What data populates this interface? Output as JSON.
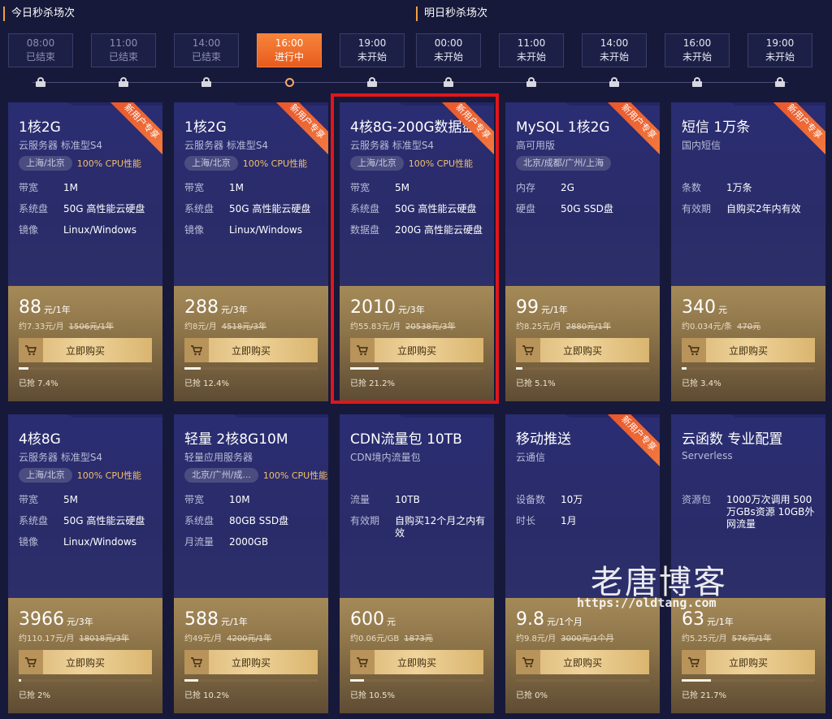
{
  "sessions": {
    "today": "今日秒杀场次",
    "tomorrow": "明日秒杀场次"
  },
  "slots": [
    {
      "time": "08:00",
      "status": "已结束"
    },
    {
      "time": "11:00",
      "status": "已结束"
    },
    {
      "time": "14:00",
      "status": "已结束"
    },
    {
      "time": "16:00",
      "status": "进行中"
    },
    {
      "time": "19:00",
      "status": "未开始"
    },
    {
      "time": "00:00",
      "status": "未开始"
    },
    {
      "time": "11:00",
      "status": "未开始"
    },
    {
      "time": "14:00",
      "status": "未开始"
    },
    {
      "time": "16:00",
      "status": "未开始"
    },
    {
      "time": "19:00",
      "status": "未开始"
    }
  ],
  "ribbon_text": "新用户专享",
  "buy_label": "立即购买",
  "cards": [
    {
      "title": "1核2G",
      "sub": "云服务器 标准型S4",
      "region": "上海/北京",
      "cpu": "100% CPU性能",
      "specs": [
        {
          "k": "带宽",
          "v": "1M"
        },
        {
          "k": "系统盘",
          "v": "50G 高性能云硬盘"
        },
        {
          "k": "镜像",
          "v": "Linux/Windows"
        }
      ],
      "price": "88",
      "unit": "元/1年",
      "per": "约7.33元/月",
      "orig": "1506元/1年",
      "sold": "已抢 7.4%",
      "progress": 0.074,
      "ribbon": true
    },
    {
      "title": "1核2G",
      "sub": "云服务器 标准型S4",
      "region": "上海/北京",
      "cpu": "100% CPU性能",
      "specs": [
        {
          "k": "带宽",
          "v": "1M"
        },
        {
          "k": "系统盘",
          "v": "50G 高性能云硬盘"
        },
        {
          "k": "镜像",
          "v": "Linux/Windows"
        }
      ],
      "price": "288",
      "unit": "元/3年",
      "per": "约8元/月",
      "orig": "4518元/3年",
      "sold": "已抢 12.4%",
      "progress": 0.124,
      "ribbon": true
    },
    {
      "title": "4核8G-200G数据盘",
      "sub": "云服务器 标准型S4",
      "region": "上海/北京",
      "cpu": "100% CPU性能",
      "specs": [
        {
          "k": "带宽",
          "v": "5M"
        },
        {
          "k": "系统盘",
          "v": "50G 高性能云硬盘"
        },
        {
          "k": "数据盘",
          "v": "200G 高性能云硬盘"
        }
      ],
      "price": "2010",
      "unit": "元/3年",
      "per": "约55.83元/月",
      "orig": "20538元/3年",
      "sold": "已抢 21.2%",
      "progress": 0.212,
      "ribbon": true
    },
    {
      "title": "MySQL 1核2G",
      "sub": "高可用版",
      "region": "北京/成都/广州/上海",
      "cpu": "",
      "specs": [
        {
          "k": "内存",
          "v": "2G"
        },
        {
          "k": "硬盘",
          "v": "50G SSD盘"
        }
      ],
      "price": "99",
      "unit": "元/1年",
      "per": "约8.25元/月",
      "orig": "2880元/1年",
      "sold": "已抢 5.1%",
      "progress": 0.051,
      "ribbon": true
    },
    {
      "title": "短信 1万条",
      "sub": "国内短信",
      "region": "",
      "cpu": "",
      "specs": [
        {
          "k": "条数",
          "v": "1万条"
        },
        {
          "k": "有效期",
          "v": "自购买2年内有效"
        }
      ],
      "price": "340",
      "unit": "元",
      "per": "约0.034元/条",
      "orig": "470元",
      "sold": "已抢 3.4%",
      "progress": 0.034,
      "ribbon": true
    },
    {
      "title": "4核8G",
      "sub": "云服务器 标准型S4",
      "region": "上海/北京",
      "cpu": "100% CPU性能",
      "specs": [
        {
          "k": "带宽",
          "v": "5M"
        },
        {
          "k": "系统盘",
          "v": "50G 高性能云硬盘"
        },
        {
          "k": "镜像",
          "v": "Linux/Windows"
        }
      ],
      "price": "3966",
      "unit": "元/3年",
      "per": "约110.17元/月",
      "orig": "18018元/3年",
      "sold": "已抢 2%",
      "progress": 0.02,
      "ribbon": false
    },
    {
      "title": "轻量 2核8G10M",
      "sub": "轻量应用服务器",
      "region": "北京/广州/成...",
      "cpu": "100% CPU性能",
      "specs": [
        {
          "k": "带宽",
          "v": "10M"
        },
        {
          "k": "系统盘",
          "v": "80GB SSD盘"
        },
        {
          "k": "月流量",
          "v": "2000GB"
        }
      ],
      "price": "588",
      "unit": "元/1年",
      "per": "约49元/月",
      "orig": "4200元/1年",
      "sold": "已抢 10.2%",
      "progress": 0.102,
      "ribbon": false
    },
    {
      "title": "CDN流量包 10TB",
      "sub": "CDN境内流量包",
      "region": "",
      "cpu": "",
      "specs": [
        {
          "k": "流量",
          "v": "10TB"
        },
        {
          "k": "有效期",
          "v": "自购买12个月之内有效"
        }
      ],
      "price": "600",
      "unit": "元",
      "per": "约0.06元/GB",
      "orig": "1873元",
      "sold": "已抢 10.5%",
      "progress": 0.105,
      "ribbon": false
    },
    {
      "title": "移动推送",
      "sub": "云通信",
      "region": "",
      "cpu": "",
      "specs": [
        {
          "k": "设备数",
          "v": "10万"
        },
        {
          "k": "时长",
          "v": "1月"
        }
      ],
      "price": "9.8",
      "unit": "元/1个月",
      "per": "约9.8元/月",
      "orig": "3000元/1个月",
      "sold": "已抢 0%",
      "progress": 0.0,
      "ribbon": true
    },
    {
      "title": "云函数 专业配置",
      "sub": "Serverless",
      "region": "",
      "cpu": "",
      "specs": [
        {
          "k": "资源包",
          "v": "1000万次调用 500万GBs资源 10GB外网流量"
        }
      ],
      "price": "63",
      "unit": "元/1年",
      "per": "约5.25元/月",
      "orig": "576元/1年",
      "sold": "已抢 21.7%",
      "progress": 0.217,
      "ribbon": false
    }
  ],
  "watermark": {
    "title": "老唐博客",
    "url": "https://oldtang.com"
  },
  "colors": {
    "accent": "#f7843a",
    "highlight": "#e0161c",
    "bg": "#17193a"
  }
}
